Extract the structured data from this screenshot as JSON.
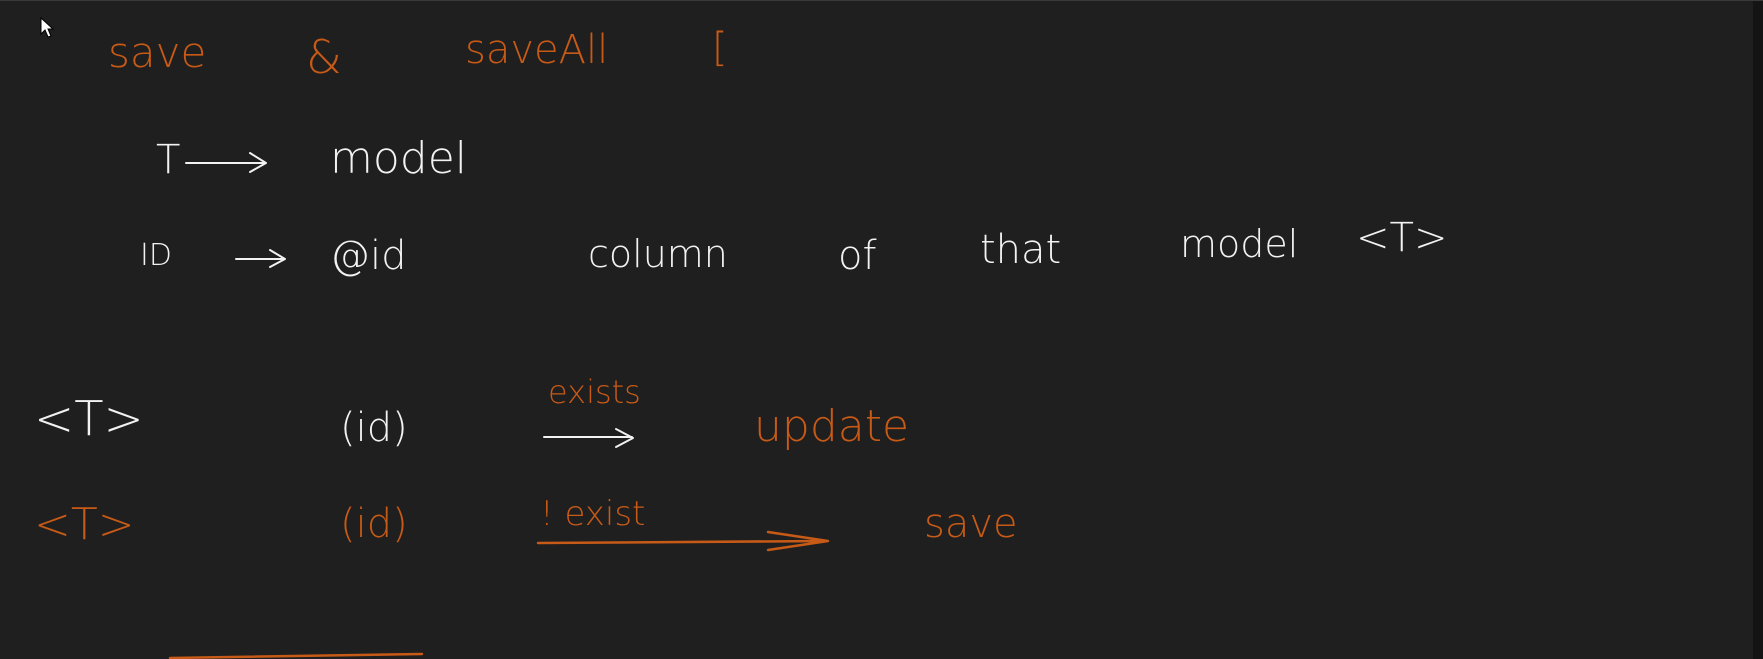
{
  "canvas": {
    "background": "#1f1f1f",
    "ink_white": "#f2f2f2",
    "ink_orange": "#c75a16"
  },
  "notes": {
    "line1": {
      "save": "save",
      "amp": "&",
      "saveall": "saveAll",
      "bracket": "["
    },
    "line2": {
      "t": "T",
      "model": "model"
    },
    "line3": {
      "id": "ID",
      "at_id": "@id",
      "column": "column",
      "of": "of",
      "that": "that",
      "model": "model",
      "t_generic": "<T>"
    },
    "line4": {
      "t_generic": "<T>",
      "id_paren": "(id)",
      "exists": "exists",
      "update": "update"
    },
    "line5": {
      "t_generic": "<T>",
      "id_paren": "(id)",
      "not_exist": "! exist",
      "save": "save"
    }
  },
  "icons": {
    "cursor": "mouse-pointer-icon"
  }
}
